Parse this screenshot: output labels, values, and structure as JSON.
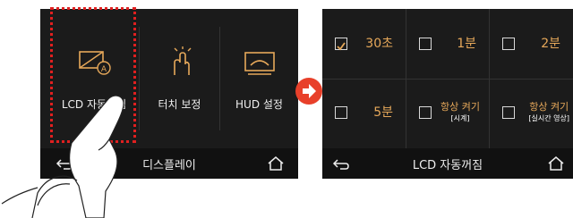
{
  "left": {
    "tiles": [
      {
        "label": "LCD 자동꺼짐",
        "icon": "lcd-auto-off-icon"
      },
      {
        "label": "터치 보정",
        "icon": "touch-calibration-icon"
      },
      {
        "label": "HUD 설정",
        "icon": "hud-settings-icon"
      }
    ],
    "bottom_title": "디스플레이",
    "back_icon": "back-arrow-icon",
    "home_icon": "home-icon"
  },
  "right": {
    "options": [
      {
        "text": "30초",
        "checked": true
      },
      {
        "text": "1분",
        "checked": false
      },
      {
        "text": "2분",
        "checked": false
      },
      {
        "text": "5분",
        "checked": false
      },
      {
        "text": "항상 켜기",
        "sub": "[시계]",
        "checked": false
      },
      {
        "text": "항상 켜기",
        "sub": "[실시간 영상]",
        "checked": false
      }
    ],
    "bottom_title": "LCD 자동꺼짐",
    "back_icon": "back-arrow-icon",
    "home_icon": "home-icon"
  },
  "colors": {
    "accent": "#e6a85a",
    "highlight": "#e02020",
    "arrow": "#e8402a"
  }
}
